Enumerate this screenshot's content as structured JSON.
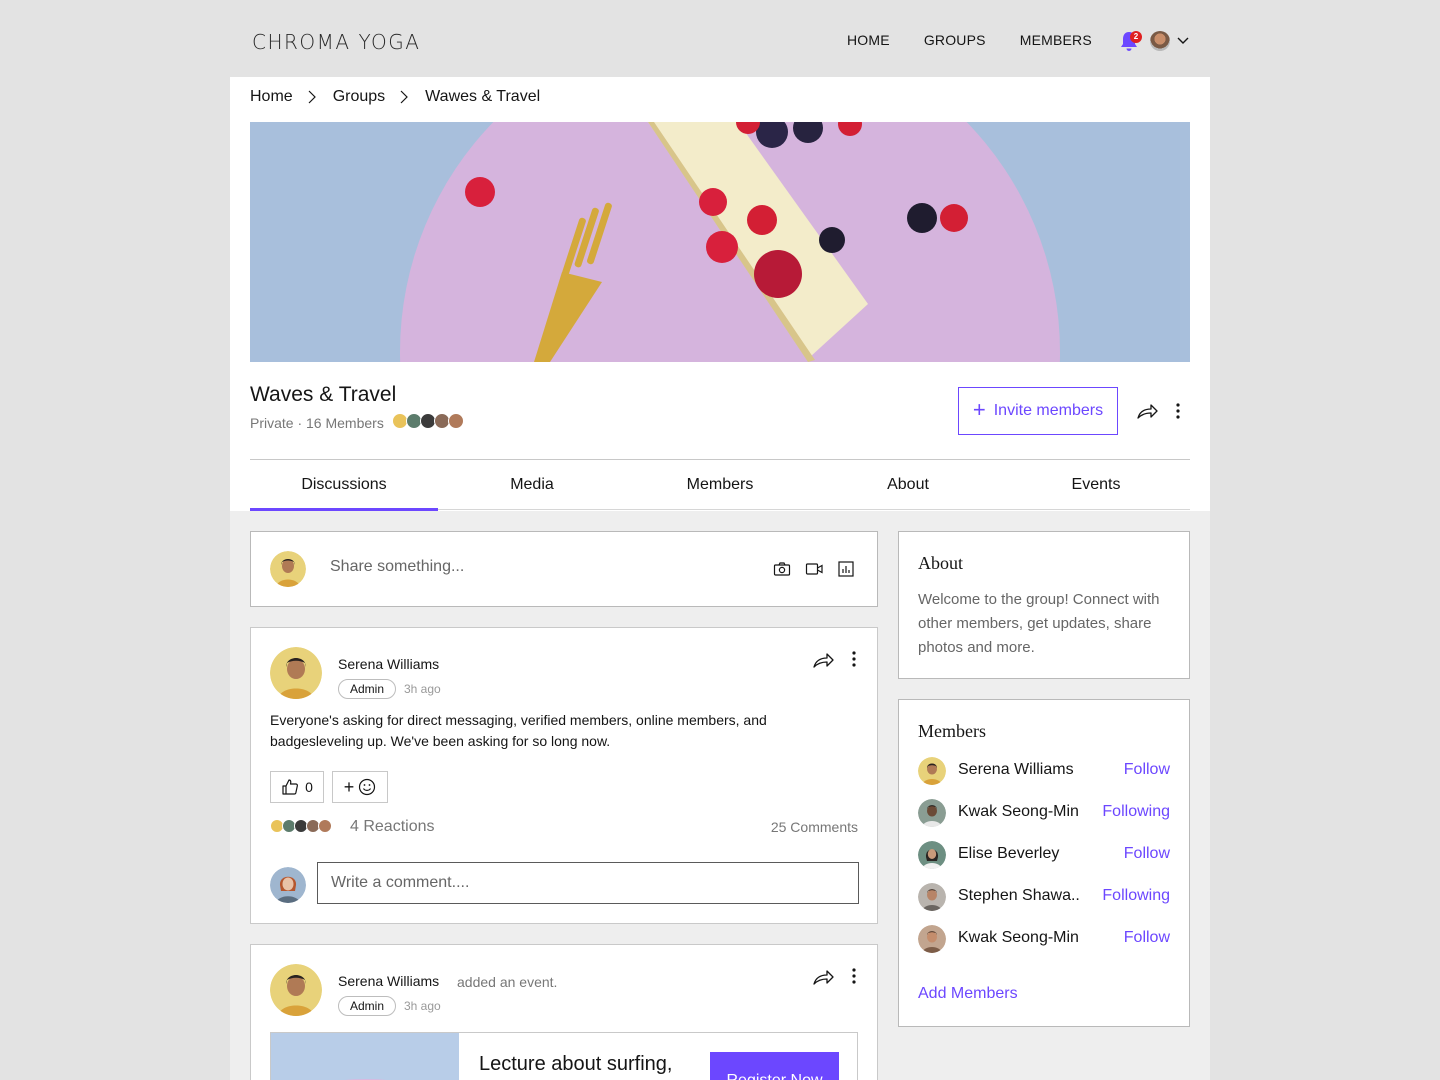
{
  "brand": {
    "logo_text": "CHROMA YOGA"
  },
  "nav": {
    "links": [
      "HOME",
      "GROUPS",
      "MEMBERS"
    ],
    "notification_count": "2",
    "icons": [
      "bell-icon",
      "avatar",
      "chevron-down-icon"
    ]
  },
  "breadcrumb": [
    "Home",
    "Groups",
    "Wawes & Travel"
  ],
  "group": {
    "name": "Waves & Travel",
    "meta": "Private · 16 Members",
    "invite_label": "Invite members"
  },
  "tabs": [
    "Discussions",
    "Media",
    "Members",
    "About",
    "Events"
  ],
  "active_tab": "Discussions",
  "composer": {
    "placeholder": "Share something...",
    "icons": [
      "camera-icon",
      "video-icon",
      "poll-icon"
    ]
  },
  "posts": [
    {
      "author": "Serena Williams",
      "role": "Admin",
      "time": "3h ago",
      "text": "Everyone's asking for direct messaging, verified members, online members, and badgesleveling up. We've been asking for so long now.",
      "likes": "0",
      "reactions": "4 Reactions",
      "comments": "25 Comments",
      "comment_placeholder": "Write a comment...."
    },
    {
      "author": "Serena Williams",
      "action": "added an event.",
      "role": "Admin",
      "time": "3h ago",
      "event_title": "Lecture about surfing,",
      "register_label": "Register Now"
    }
  ],
  "about": {
    "title": "About",
    "text": "Welcome to the group! Connect with other members, get updates, share photos and more."
  },
  "members": {
    "title": "Members",
    "list": [
      {
        "name": "Serena Williams",
        "action": "Follow"
      },
      {
        "name": "Kwak Seong-Min",
        "action": "Following"
      },
      {
        "name": "Elise Beverley",
        "action": "Follow"
      },
      {
        "name": "Stephen Shawa..",
        "action": "Following"
      },
      {
        "name": "Kwak Seong-Min",
        "action": "Follow"
      }
    ],
    "add_label": "Add Members"
  },
  "colors": {
    "accent": "#6c47ff",
    "badge": "#e02020",
    "page_bg": "#e3e3e3"
  }
}
